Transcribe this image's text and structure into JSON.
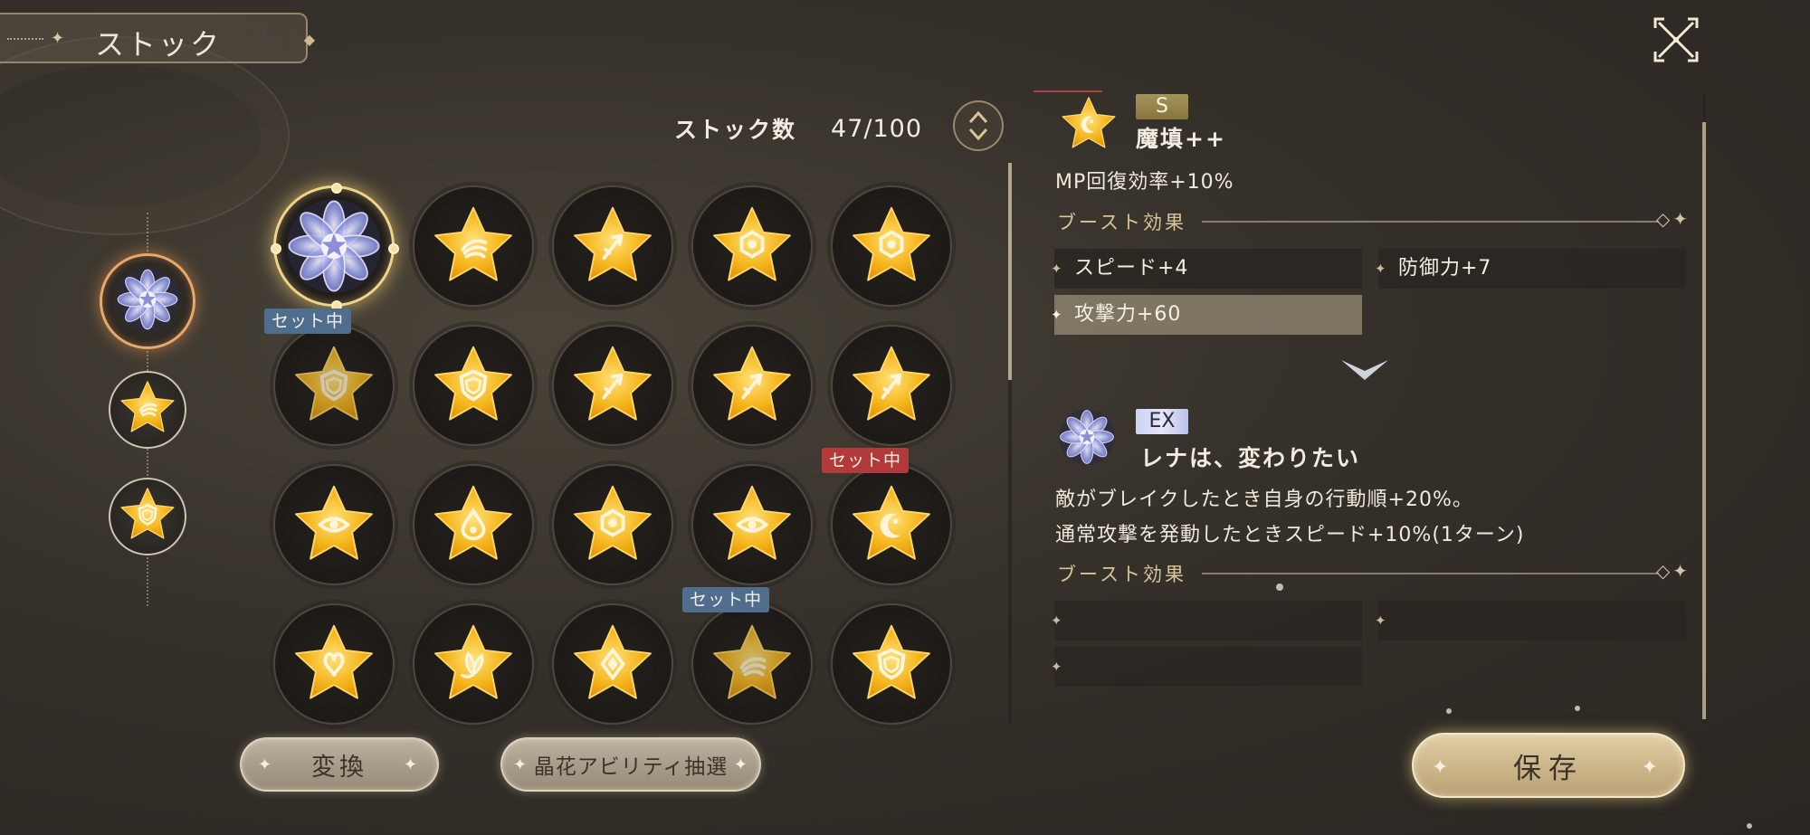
{
  "header": {
    "title": "ストック",
    "close_icon": "close-x-icon"
  },
  "stock": {
    "label": "ストック数",
    "value": "47/100"
  },
  "rail": [
    {
      "icon": "flower-crest-icon",
      "selected": true
    },
    {
      "icon": "wing-star-icon",
      "selected": false
    },
    {
      "icon": "shield-star-icon",
      "selected": false
    }
  ],
  "grid": {
    "rows": [
      [
        {
          "icon": "flower-crest-icon",
          "kind": "flower",
          "selected": true,
          "badge": ""
        },
        {
          "icon": "wing-star-icon",
          "kind": "wing",
          "badge": ""
        },
        {
          "icon": "arrow-star-icon",
          "kind": "arrow",
          "badge": ""
        },
        {
          "icon": "gear-eye-star-icon",
          "kind": "gear",
          "badge": ""
        },
        {
          "icon": "gear-eye-star-icon",
          "kind": "gear",
          "badge": ""
        }
      ],
      [
        {
          "icon": "shield-star-icon",
          "kind": "shield",
          "badge": "セット中",
          "badge_color": "blue",
          "dim": true
        },
        {
          "icon": "shield-star-icon",
          "kind": "shield",
          "badge": ""
        },
        {
          "icon": "arrow-star-icon",
          "kind": "arrow",
          "badge": ""
        },
        {
          "icon": "arrow-star-icon",
          "kind": "arrow",
          "badge": ""
        },
        {
          "icon": "arrow-star-icon",
          "kind": "arrow",
          "badge": ""
        }
      ],
      [
        {
          "icon": "eye-star-icon",
          "kind": "eye",
          "badge": ""
        },
        {
          "icon": "drop-star-icon",
          "kind": "drop",
          "badge": ""
        },
        {
          "icon": "gear-eye-star-icon",
          "kind": "gear",
          "badge": ""
        },
        {
          "icon": "eye-star-icon",
          "kind": "eye",
          "badge": ""
        },
        {
          "icon": "moon-star-icon",
          "kind": "moon",
          "badge": "セット中",
          "badge_color": "red"
        }
      ],
      [
        {
          "icon": "knot-star-icon",
          "kind": "knot",
          "badge": ""
        },
        {
          "icon": "leaf-star-icon",
          "kind": "leaf",
          "badge": ""
        },
        {
          "icon": "diamond-star-icon",
          "kind": "diamond",
          "badge": ""
        },
        {
          "icon": "wing-star-icon",
          "kind": "wing",
          "badge": "セット中",
          "badge_color": "blue",
          "dim": true
        },
        {
          "icon": "shield-star-icon",
          "kind": "shield",
          "badge": ""
        }
      ]
    ]
  },
  "buttons": {
    "convert": "変換",
    "draw": "晶花アビリティ抽選",
    "save": "保存"
  },
  "detail": {
    "ability1": {
      "rank": "S",
      "name": "魔填++",
      "icon": "moon-star-icon",
      "desc": "MP回復効率+10%",
      "boost_header": "ブースト効果",
      "boosts": [
        "スピード+4",
        "防御力+7",
        "攻撃力+60"
      ]
    },
    "ability2": {
      "rank": "EX",
      "name": "レナは、変わりたい",
      "icon": "flower-crest-icon",
      "desc_lines": [
        "敵がブレイクしたとき自身の行動順+20%。",
        "通常攻撃を発動したときスピード+10%(1ターン)"
      ],
      "boost_header": "ブースト効果",
      "boosts": [
        "",
        "",
        ""
      ]
    }
  },
  "colors": {
    "accent_gold": "#f0d48a",
    "badge_blue": "#4f6e8d",
    "badge_red": "#b23a3a",
    "star_gold": "#f5b51c"
  }
}
